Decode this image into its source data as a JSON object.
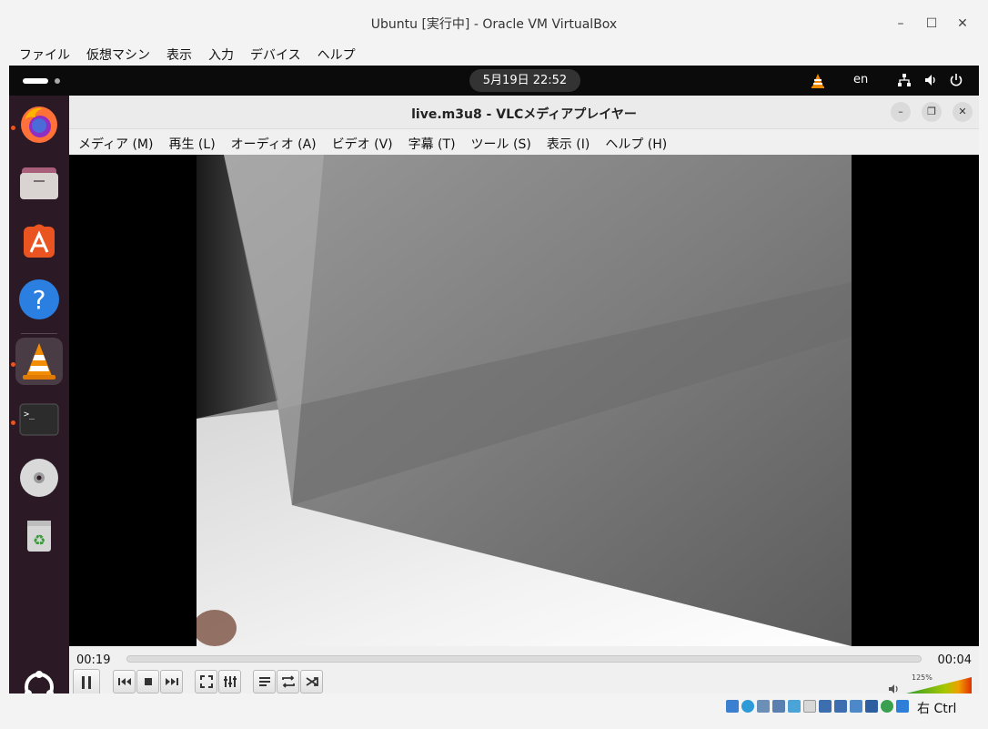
{
  "vbox": {
    "title": "Ubuntu [実行中] - Oracle VM VirtualBox",
    "menu": [
      "ファイル",
      "仮想マシン",
      "表示",
      "入力",
      "デバイス",
      "ヘルプ"
    ],
    "host_key": "右 Ctrl"
  },
  "gnome": {
    "clock": "5月19日  22:52",
    "lang": "en"
  },
  "dock": {
    "items": [
      "firefox",
      "files",
      "app-center",
      "help",
      "vlc",
      "terminal",
      "dvd",
      "trash"
    ],
    "show_apps": "show-apps"
  },
  "vlc": {
    "title": "live.m3u8 - VLCメディアプレイヤー",
    "menu": [
      "メディア (M)",
      "再生 (L)",
      "オーディオ (A)",
      "ビデオ (V)",
      "字幕 (T)",
      "ツール (S)",
      "表示 (I)",
      "ヘルプ (H)"
    ],
    "time_current": "00:19",
    "time_total": "00:04",
    "volume_percent": "125%",
    "volume_level": 1.25
  }
}
